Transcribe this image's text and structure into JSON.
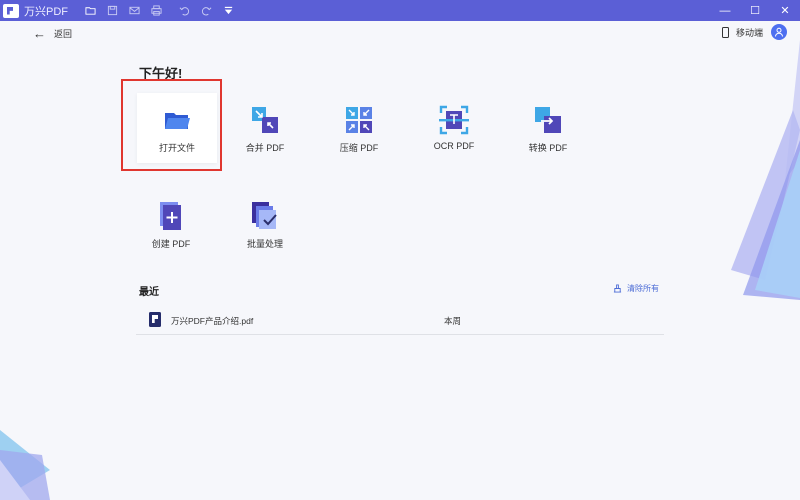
{
  "titlebar": {
    "app_name": "万兴PDF",
    "icons": [
      "folder-icon",
      "save-icon",
      "mail-icon",
      "print-icon",
      "undo-icon",
      "redo-icon",
      "dropdown-icon"
    ],
    "window_buttons": [
      "—",
      "☐",
      "✕"
    ]
  },
  "nav": {
    "back_label": "返回",
    "mobile_label": "移动端"
  },
  "greeting": "下午好!",
  "tiles": [
    {
      "label": "打开文件",
      "icon": "folder-open-icon"
    },
    {
      "label": "合并 PDF",
      "icon": "merge-icon"
    },
    {
      "label": "压缩 PDF",
      "icon": "compress-icon"
    },
    {
      "label": "OCR PDF",
      "icon": "ocr-icon"
    },
    {
      "label": "转换 PDF",
      "icon": "convert-icon"
    },
    {
      "label": "创建 PDF",
      "icon": "create-icon"
    },
    {
      "label": "批量处理",
      "icon": "batch-icon"
    }
  ],
  "recent": {
    "title": "最近",
    "clear_label": "清除所有",
    "files": [
      {
        "name": "万兴PDF产品介绍.pdf",
        "date": "本周"
      }
    ]
  },
  "colors": {
    "titlebar": "#5b5fd6",
    "accent": "#4c6cd6",
    "highlight": "#e0362f"
  }
}
